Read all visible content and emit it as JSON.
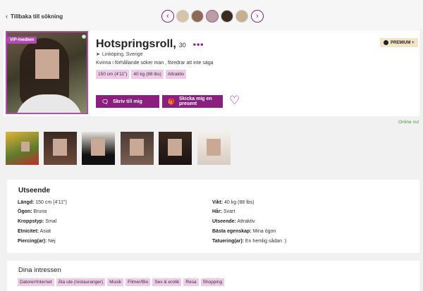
{
  "header": {
    "back_label": "Tillbaka till sökning",
    "prev_icon": "chevron-left-icon",
    "next_icon": "chevron-right-icon"
  },
  "profile": {
    "badge": "VIP-medlem",
    "name": "Hotspringsroll,",
    "age": "30",
    "location": "Linköping, Sverige",
    "tagline": "Kvinna i förhållande söker man , föredrar att inte säga",
    "chips": [
      "150 cm (4'11\")",
      "40 kg (88 lbs)",
      "Attraktiv"
    ],
    "message_button": "Skriv till mig",
    "gift_button": "Skicka mig en present",
    "premium_label": "PREMIUM +",
    "online_status": "Online nu!"
  },
  "about": {
    "title": "Utseende",
    "left": [
      {
        "key": "Längd:",
        "value": " 150 cm (4'11\")"
      },
      {
        "key": "Ögon:",
        "value": " Bruna"
      },
      {
        "key": "Kroppstyp:",
        "value": " Smal"
      },
      {
        "key": "Etnicitet:",
        "value": " Asiat"
      },
      {
        "key": "Piercing(ar):",
        "value": " Nej"
      }
    ],
    "right": [
      {
        "key": "Vikt:",
        "value": " 40 kg (88 lbs)"
      },
      {
        "key": "Hår:",
        "value": " Svart"
      },
      {
        "key": "Utseende:",
        "value": " Attraktiv"
      },
      {
        "key": "Bästa egenskap:",
        "value": " Mina ögon"
      },
      {
        "key": "Tatuering(ar):",
        "value": " En hemlig sådan :)"
      }
    ]
  },
  "interests": {
    "title": "Dina intressen",
    "items": [
      "Datorer/Internet",
      "Äta ute (restauranger)",
      "Musik",
      "Filmer/Bio",
      "Sex & erotik",
      "Resa",
      "Shopping"
    ]
  },
  "colors": {
    "accent": "#8a1f7f",
    "chip": "#efcbe9",
    "online": "#3a9f3a"
  }
}
